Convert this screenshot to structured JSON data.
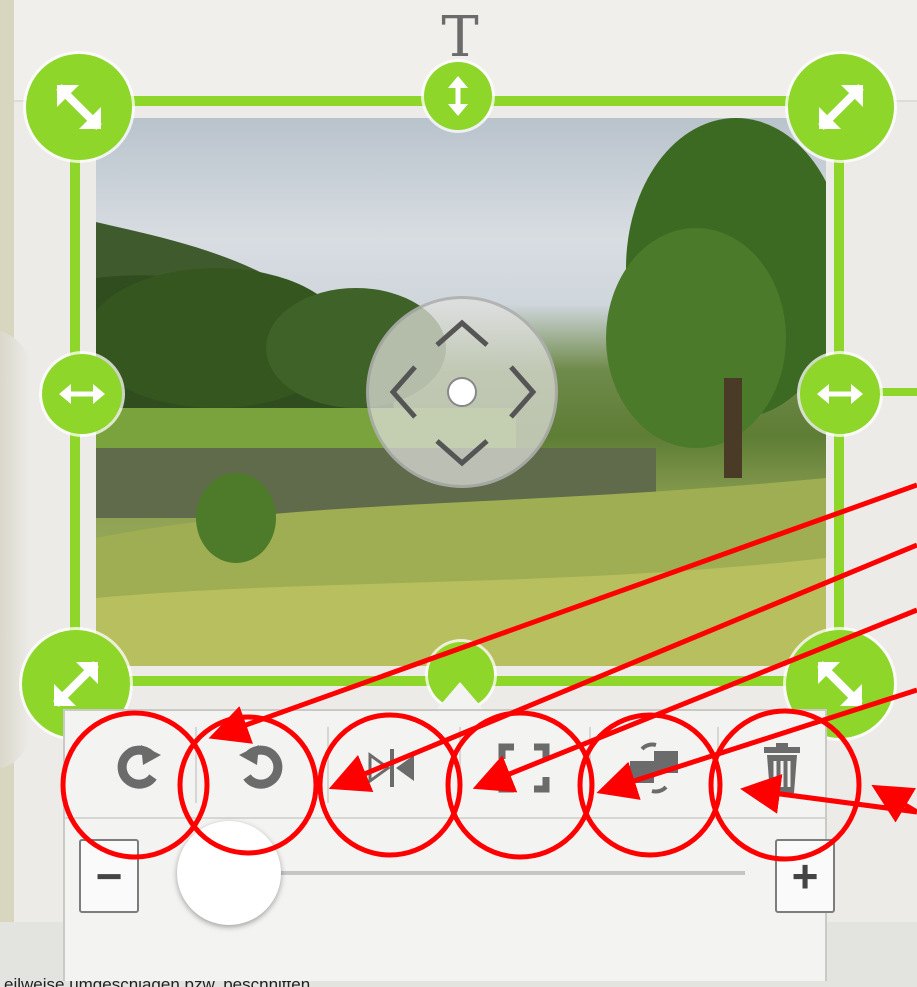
{
  "page": {
    "text_tool_glyph": "T",
    "caption": "eilweise umgeschlagen bzw. beschnitten"
  },
  "toolbar": {
    "buttons": [
      {
        "name": "rotate-right-button",
        "icon": "rotate-right-icon"
      },
      {
        "name": "rotate-left-button",
        "icon": "rotate-left-icon"
      },
      {
        "name": "flip-button",
        "icon": "flip-horizontal-icon"
      },
      {
        "name": "fit-frame-button",
        "icon": "fit-frame-icon"
      },
      {
        "name": "replace-image-button",
        "icon": "replace-image-icon"
      },
      {
        "name": "delete-button",
        "icon": "trash-icon"
      }
    ],
    "zoom_minus": "−",
    "zoom_plus": "+",
    "zoom_level": 0.01
  },
  "colors": {
    "handle": "#8ed629",
    "annotation": "#ff0000",
    "toolbar_icon": "#6b6b6b"
  }
}
